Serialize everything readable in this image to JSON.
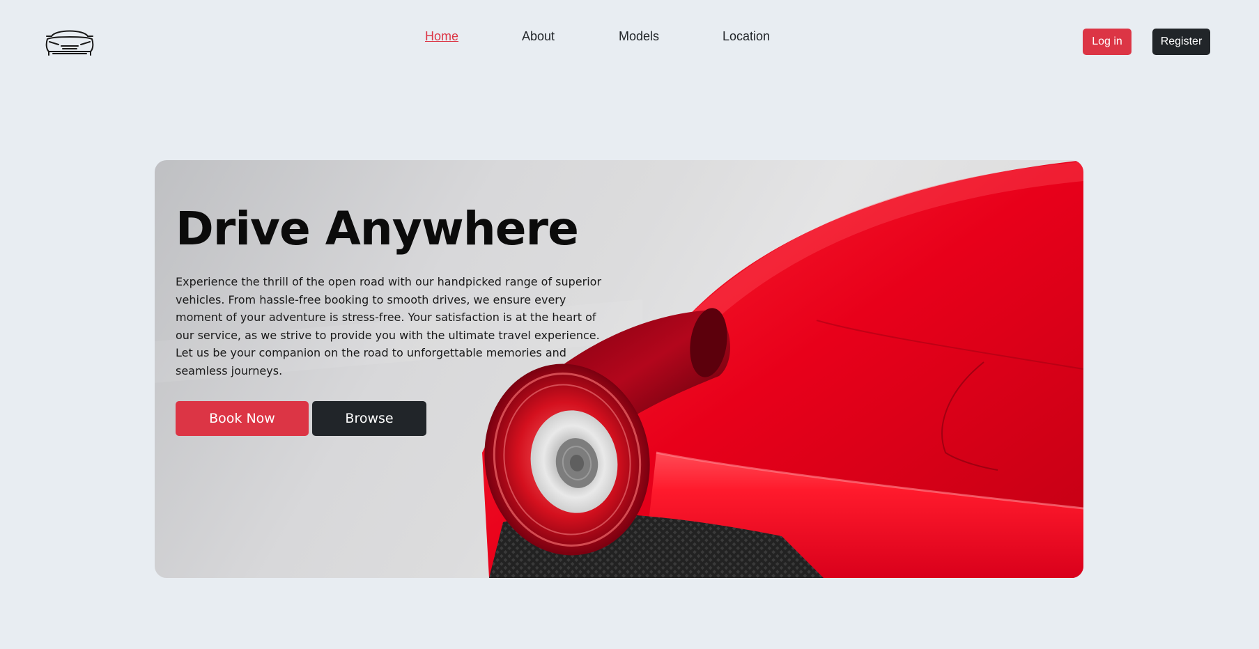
{
  "header": {
    "logo_icon": "sports-car-front-icon",
    "nav": [
      {
        "label": "Home",
        "active": true
      },
      {
        "label": "About",
        "active": false
      },
      {
        "label": "Models",
        "active": false
      },
      {
        "label": "Location",
        "active": false
      }
    ],
    "login_label": "Log in",
    "register_label": "Register"
  },
  "hero": {
    "title": "Drive Anywhere",
    "text": "Experience the thrill of the open road with our handpicked range of superior vehicles. From hassle-free booking to smooth drives, we ensure every moment of your adventure is stress-free. Your satisfaction is at the heart of our service, as we strive to provide you with the ultimate travel experience. Let us be your companion on the road to unforgettable memories and seamless journeys.",
    "book_label": "Book Now",
    "browse_label": "Browse",
    "image": "red-sports-car-taillight-image"
  },
  "colors": {
    "background": "#e8edf2",
    "accent": "#dc3545",
    "dark": "#212529"
  }
}
